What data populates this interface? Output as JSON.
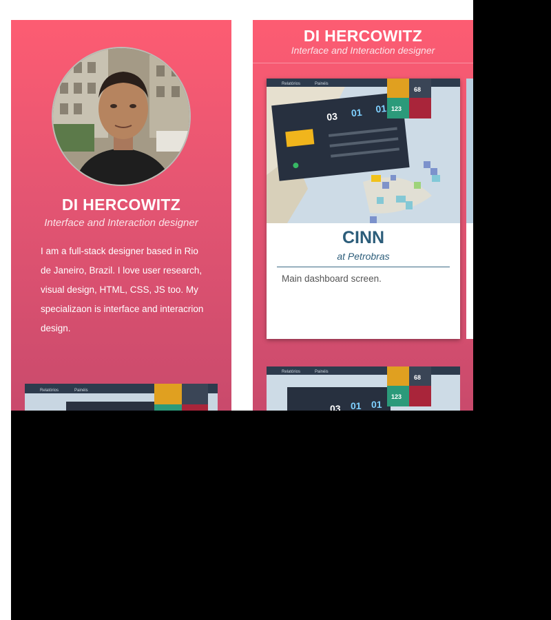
{
  "profile": {
    "name": "DI HERCOWITZ",
    "role": "Interface and Interaction designer",
    "bio": "I am a full-stack designer based in Rio de Janeiro, Brazil.  I love user research, visual design,  HTML, CSS, JS too. My specializaon is interface and interacrion design."
  },
  "panel": {
    "name": "DI HERCOWITZ",
    "role": "Interface and Interaction designer"
  },
  "project": {
    "title": "CINN",
    "company": "at Petrobras",
    "description": "Main dashboard screen."
  },
  "dashboard_mock": {
    "menu": [
      "Relatórios",
      "Painéis"
    ],
    "tile_values": [
      "03",
      "01",
      "01"
    ],
    "side_tiles": [
      "123",
      "68"
    ]
  },
  "colors": {
    "gradient_top": "#fd5c72",
    "gradient_bottom": "#c94a6c",
    "title_blue": "#2c5d7a"
  }
}
